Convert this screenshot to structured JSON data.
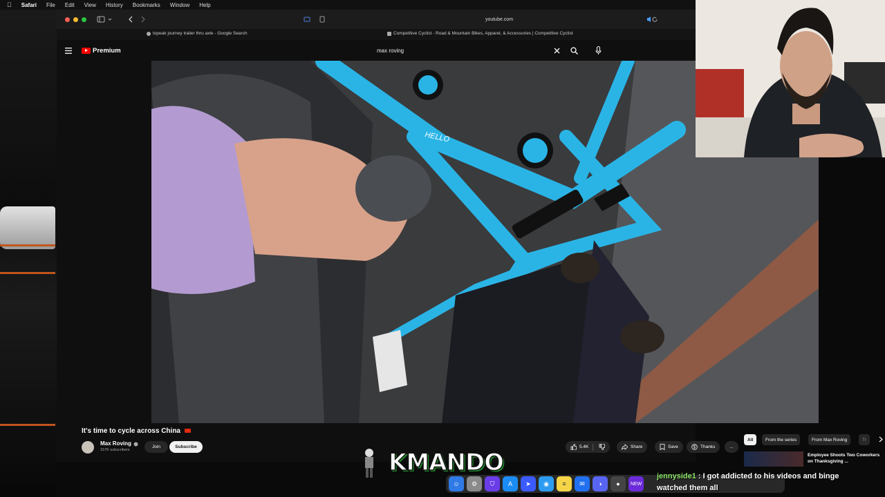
{
  "menubar": {
    "app": "Safari",
    "items": [
      "File",
      "Edit",
      "View",
      "History",
      "Bookmarks",
      "Window",
      "Help"
    ]
  },
  "browser": {
    "url": "youtube.com",
    "tabs": [
      "topeak journey trailer thru axle - Google Search",
      "Competitive Cyclist - Road & Mountain Bikes, Apparel, & Accessories | Competitive Cyclist"
    ]
  },
  "youtube": {
    "logo": "Premium",
    "search_query": "max roving"
  },
  "video": {
    "title": "It's time to cycle across China",
    "bike_text": "HELLO"
  },
  "channel": {
    "name": "Max Roving",
    "subscribers": "157K subscribers",
    "join": "Join",
    "subscribe": "Subscribe"
  },
  "actions": {
    "likes": "5.4K",
    "share": "Share",
    "save": "Save",
    "thanks": "Thanks",
    "more": "..."
  },
  "sidebar": {
    "chips": [
      "All",
      "From the series",
      "From Max Roving",
      "Tr"
    ],
    "rec_title": "Employee Shoots Two Coworkers on Thanksgiving ..."
  },
  "overlay": {
    "logo": "KMANDO",
    "chat_user": "jennyside1",
    "chat_message": "I got addicted to his videos and binge watched them all"
  },
  "colors": {
    "yt_red": "#ff0000",
    "bike_cyan": "#2ab4e6",
    "chat_green": "#8ee66b"
  }
}
